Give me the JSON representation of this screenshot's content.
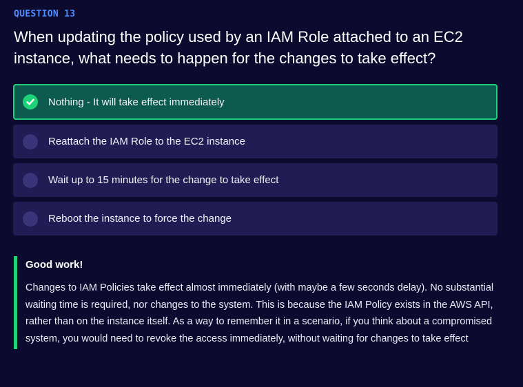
{
  "question": {
    "label": "QUESTION 13",
    "text": "When updating the policy used by an IAM Role attached to an EC2 instance, what needs to happen for the changes to take effect?"
  },
  "options": [
    {
      "label": "Nothing - It will take effect immediately",
      "selected": true,
      "icon": "check-circle-icon"
    },
    {
      "label": "Reattach the IAM Role to the EC2 instance",
      "selected": false,
      "icon": "radio-icon"
    },
    {
      "label": "Wait up to 15 minutes for the change to take effect",
      "selected": false,
      "icon": "radio-icon"
    },
    {
      "label": "Reboot the instance to force the change",
      "selected": false,
      "icon": "radio-icon"
    }
  ],
  "feedback": {
    "title": "Good work!",
    "body": "Changes to IAM Policies take effect almost immediately (with maybe a few seconds delay). No substantial waiting time is required, nor changes to the system. This is because the IAM Policy exists in the AWS API, rather than on the instance itself. As a way to remember it in a scenario, if you think about a compromised system, you would need to revoke the access immediately, without waiting for changes to take effect"
  },
  "colors": {
    "background": "#0c0a2e",
    "accent_blue": "#4f8cff",
    "correct_green": "#1ed27a",
    "selected_bg": "#0d5a4f",
    "option_bg": "#221c54"
  }
}
